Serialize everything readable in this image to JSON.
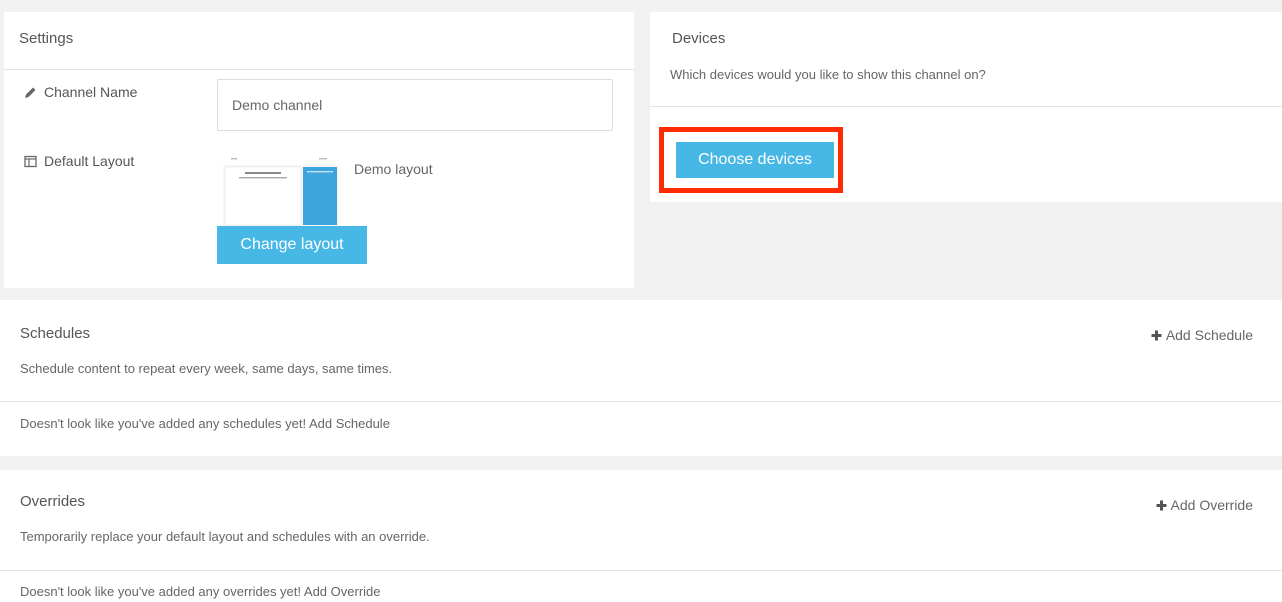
{
  "settings": {
    "title": "Settings",
    "channel_name_label": "Channel Name",
    "channel_name_value": "Demo channel",
    "default_layout_label": "Default Layout",
    "layout_name": "Demo layout",
    "change_layout_label": "Change layout"
  },
  "devices": {
    "title": "Devices",
    "subtitle": "Which devices would you like to show this channel on?",
    "choose_label": "Choose devices"
  },
  "schedules": {
    "title": "Schedules",
    "subtitle": "Schedule content to repeat every week, same days, same times.",
    "add_label": "Add Schedule",
    "empty_text": "Doesn't look like you've added any schedules yet! Add Schedule"
  },
  "overrides": {
    "title": "Overrides",
    "subtitle": "Temporarily replace your default layout and schedules with an override.",
    "add_label": "Add Override",
    "empty_text": "Doesn't look like you've added any overrides yet! Add Override"
  },
  "colors": {
    "accent": "#47b8e6",
    "highlight": "#ff2a00",
    "layout_stripe": "#c0173d"
  }
}
